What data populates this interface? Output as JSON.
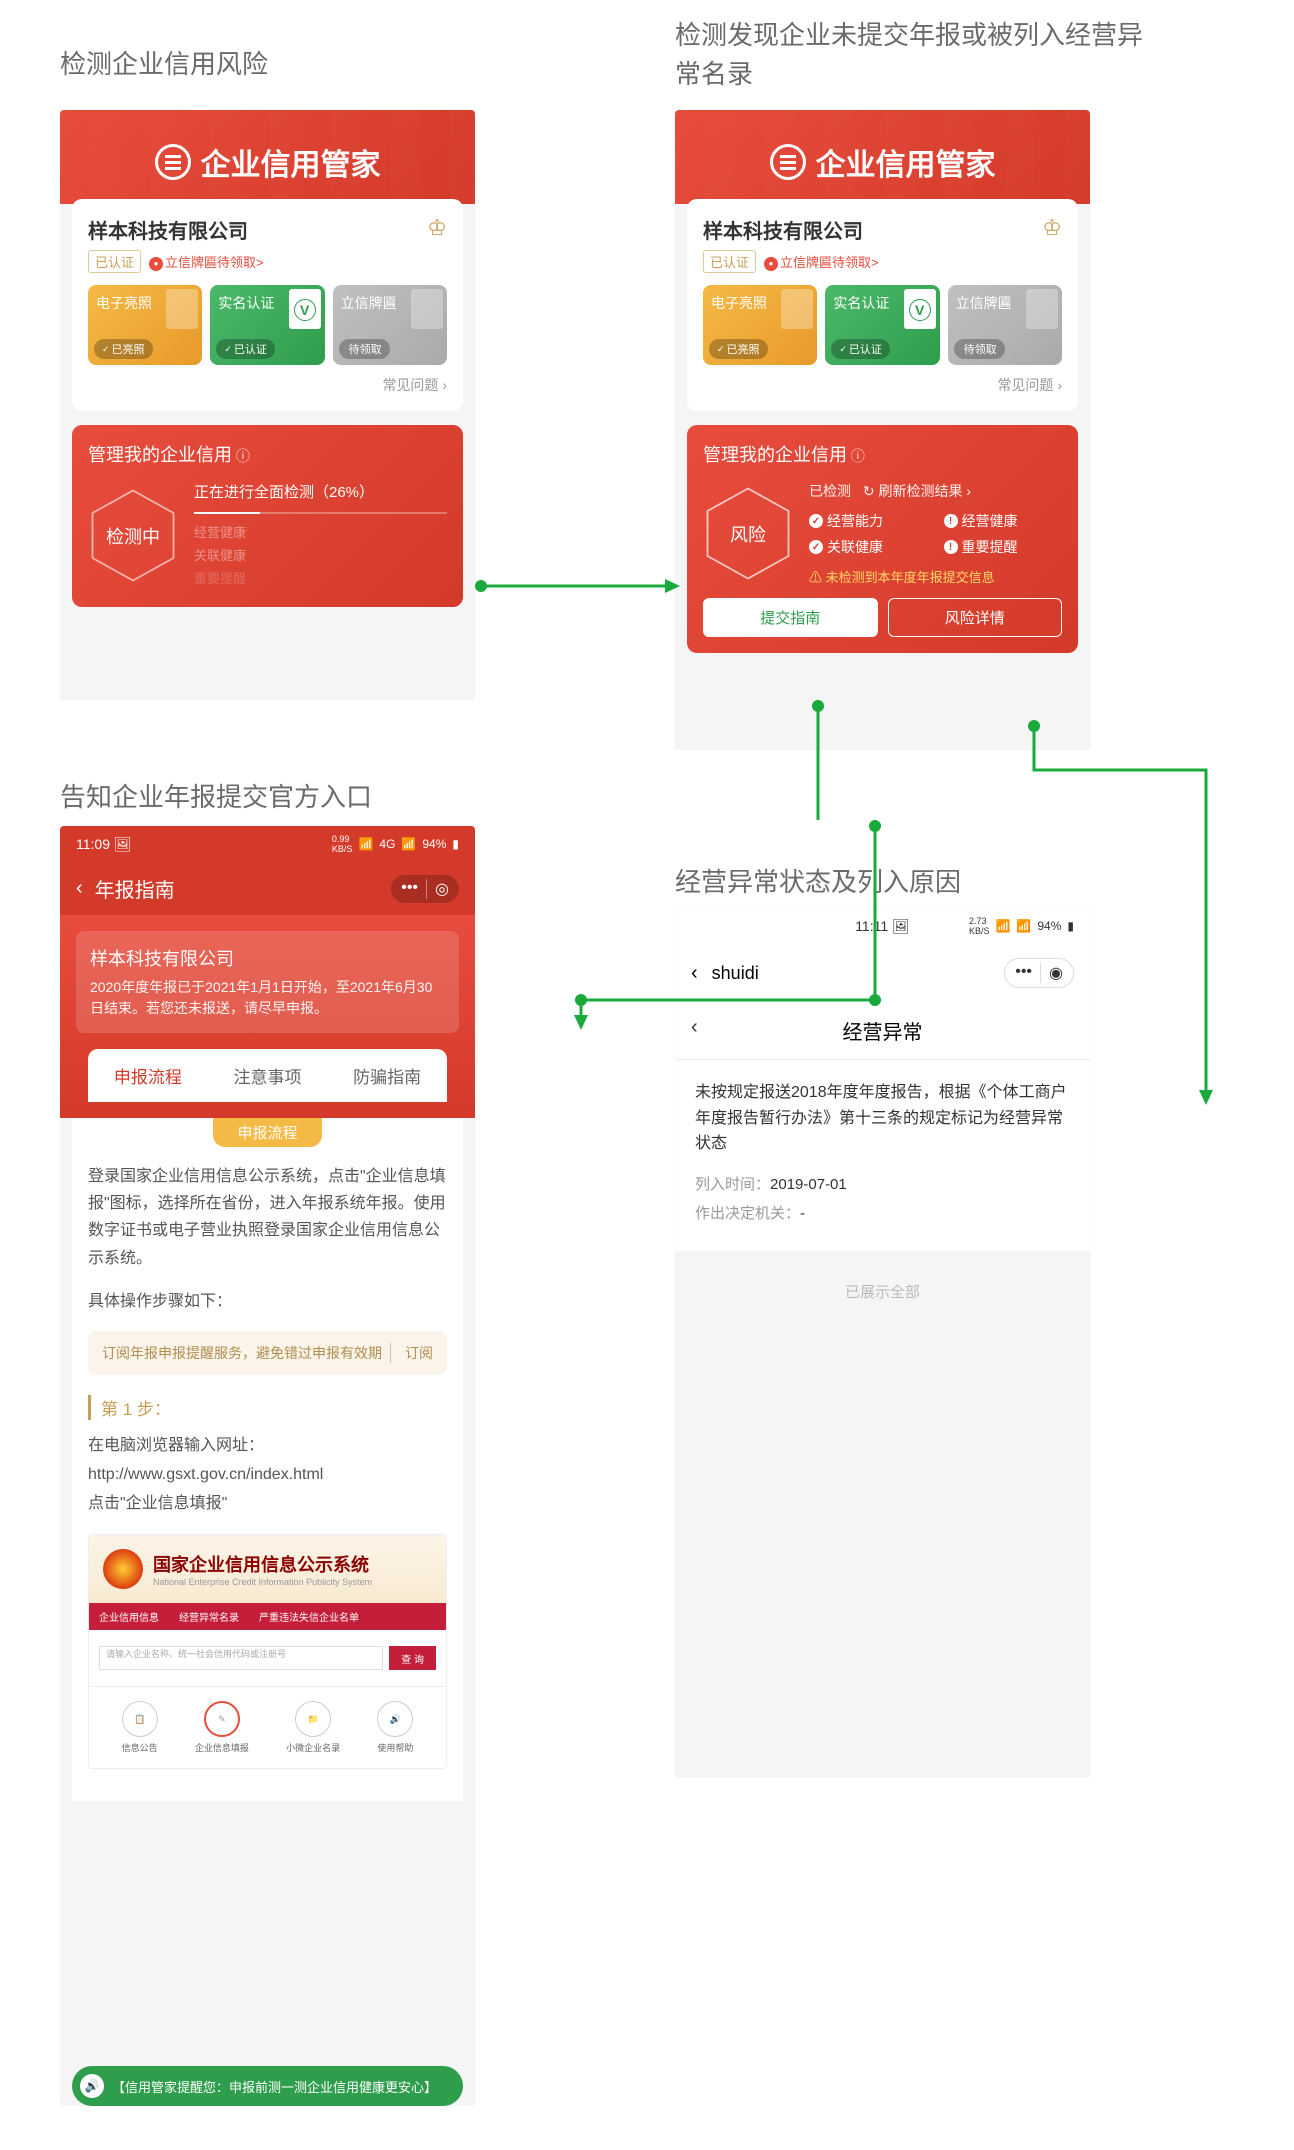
{
  "captions": {
    "s1": "检测企业信用风险",
    "s2": "检测发现企业未提交年报或被列入经营异常名录",
    "s3": "告知企业年报提交官方入口",
    "s4": "经营异常状态及列入原因"
  },
  "app": {
    "logo_text": "企业信用管家",
    "company_name": "样本科技有限公司",
    "verified": "已认证",
    "plaque_pending": "立信牌匾待领取>",
    "faq": "常见问题"
  },
  "tiles": {
    "t1": {
      "title": "电子亮照",
      "status": "已亮照"
    },
    "t2": {
      "title": "实名认证",
      "status": "已认证"
    },
    "t3": {
      "title": "立信牌匾",
      "status": "待领取"
    }
  },
  "manage": {
    "title": "管理我的企业信用",
    "scanning": "检测中",
    "progress": "正在进行全面检测（26%）",
    "dim1": "经营健康",
    "dim2": "关联健康",
    "dim3": "重要提醒"
  },
  "risk": {
    "hex": "风险",
    "refresh_label": "已检测",
    "refresh_action": "刷新检测结果 ›",
    "c1": "经营能力",
    "c2": "经营健康",
    "c3": "关联健康",
    "c4": "重要提醒",
    "warning": "未检测到本年度年报提交信息",
    "btn_guide": "提交指南",
    "btn_detail": "风险详情"
  },
  "guide": {
    "status_time": "11:09",
    "status_net": "0.99",
    "status_net_unit": "KB/S",
    "status_sig": "4G",
    "status_batt": "94%",
    "nav_title": "年报指南",
    "company": "样本科技有限公司",
    "notice": "2020年度年报已于2021年1月1日开始，至2021年6月30日结束。若您还未报送，请尽早申报。",
    "tabs": {
      "t1": "申报流程",
      "t2": "注意事项",
      "t3": "防骗指南"
    },
    "section": "申报流程",
    "text1": "登录国家企业信用信息公示系统，点击\"企业信息填报\"图标，选择所在省份，进入年报系统年报。使用数字证书或电子营业执照登录国家企业信用信息公示系统。",
    "text2": "具体操作步骤如下：",
    "subscribe": "订阅年报申报提醒服务，避免错过申报有效期",
    "subscribe_btn": "订阅",
    "step1_label": "第 1 步：",
    "step1_line1": "在电脑浏览器输入网址：",
    "step1_url": "http://www.gsxt.gov.cn/index.html",
    "step1_line2": "点击\"企业信息填报\"",
    "tip": "【信用管家提醒您：申报前测一测企业信用健康更安心】"
  },
  "gsxt": {
    "title": "国家企业信用信息公示系统",
    "sub": "National Enterprise Credit Information Publicity System",
    "nav1": "企业信用信息",
    "nav2": "经营异常名录",
    "nav3": "严重违法失信企业名单",
    "placeholder": "请输入企业名称、统一社会信用代码或注册号",
    "search": "查 询",
    "icon1": "信息公告",
    "icon2": "企业信息填报",
    "icon3": "小微企业名录",
    "icon4": "使用帮助"
  },
  "abnormal": {
    "status_time": "11:11",
    "status_net": "2.73",
    "status_net_unit": "KB/S",
    "status_batt": "94%",
    "nav_title": "shuidi",
    "header": "经营异常",
    "desc": "未按规定报送2018年度年度报告，根据《个体工商户年度报告暂行办法》第十三条的规定标记为经营异常状态",
    "date_label": "列入时间：",
    "date_value": "2019-07-01",
    "org_label": "作出决定机关：",
    "org_value": "-",
    "footer": "已展示全部"
  }
}
